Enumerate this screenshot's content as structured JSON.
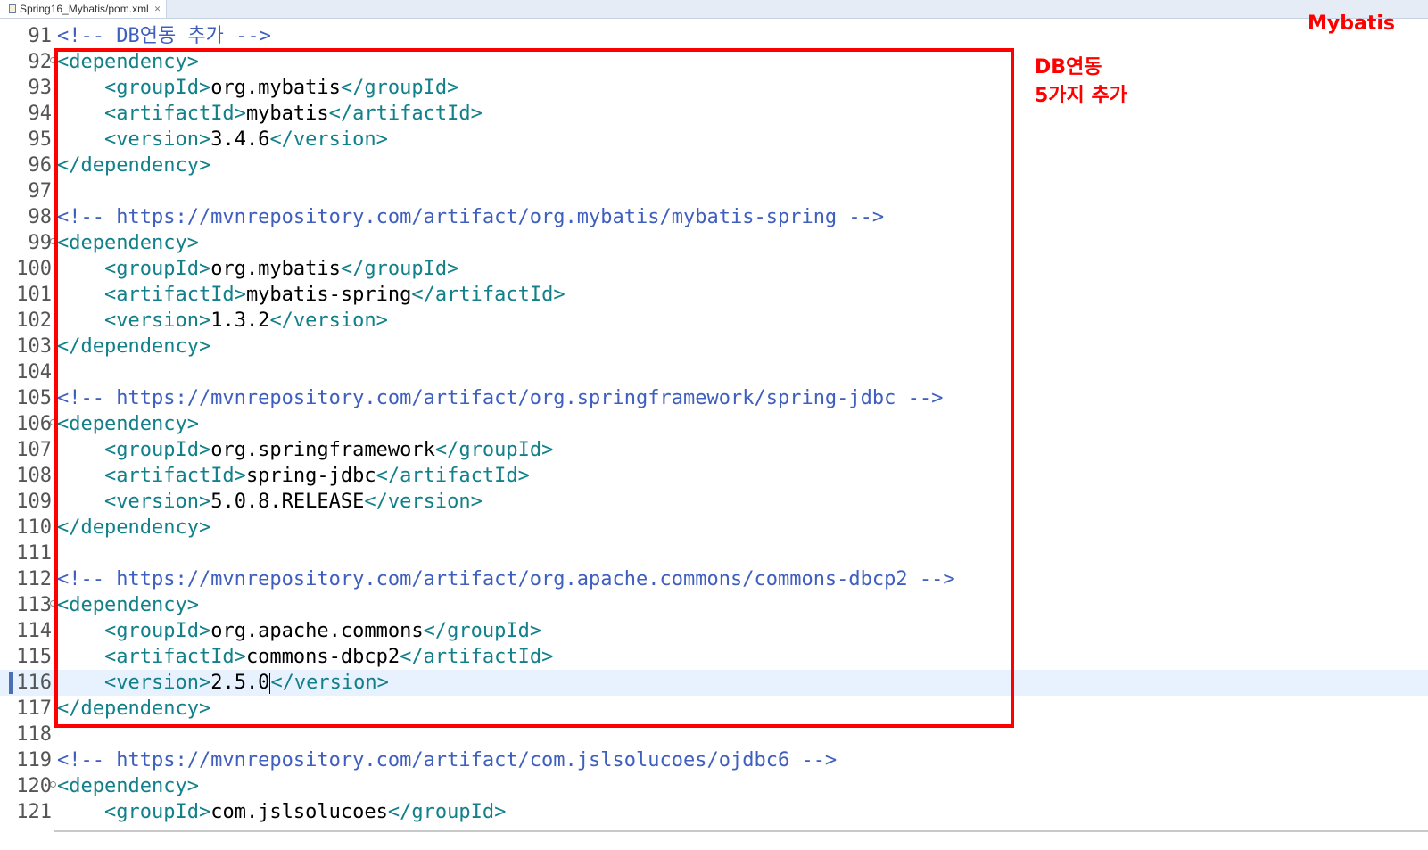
{
  "tab": {
    "title": "Spring16_Mybatis/pom.xml",
    "file_icon": "xml-file-icon",
    "close_glyph": "✕"
  },
  "annotations": {
    "corner": "Mybatis",
    "note_line1": "DB연동",
    "note_line2": "5가지 추가",
    "box_color": "#ff0000"
  },
  "editor": {
    "current_line": 116,
    "lines": [
      {
        "n": "91",
        "segs": [
          {
            "k": "cmt",
            "t": "<!-- DB연동 추가 -->"
          }
        ]
      },
      {
        "n": "92",
        "fold": true,
        "segs": [
          {
            "k": "tag",
            "t": "<dependency>"
          }
        ]
      },
      {
        "n": "93",
        "segs": [
          {
            "k": "txt",
            "t": "    "
          },
          {
            "k": "tag",
            "t": "<groupId>"
          },
          {
            "k": "txt",
            "t": "org.mybatis"
          },
          {
            "k": "tag",
            "t": "</groupId>"
          }
        ]
      },
      {
        "n": "94",
        "segs": [
          {
            "k": "txt",
            "t": "    "
          },
          {
            "k": "tag",
            "t": "<artifactId>"
          },
          {
            "k": "txt",
            "t": "mybatis"
          },
          {
            "k": "tag",
            "t": "</artifactId>"
          }
        ]
      },
      {
        "n": "95",
        "segs": [
          {
            "k": "txt",
            "t": "    "
          },
          {
            "k": "tag",
            "t": "<version>"
          },
          {
            "k": "txt",
            "t": "3.4.6"
          },
          {
            "k": "tag",
            "t": "</version>"
          }
        ]
      },
      {
        "n": "96",
        "segs": [
          {
            "k": "tag",
            "t": "</dependency>"
          }
        ]
      },
      {
        "n": "97",
        "segs": []
      },
      {
        "n": "98",
        "segs": [
          {
            "k": "cmt",
            "t": "<!-- https://mvnrepository.com/artifact/org.mybatis/mybatis-spring -->"
          }
        ]
      },
      {
        "n": "99",
        "fold": true,
        "segs": [
          {
            "k": "tag",
            "t": "<dependency>"
          }
        ]
      },
      {
        "n": "100",
        "segs": [
          {
            "k": "txt",
            "t": "    "
          },
          {
            "k": "tag",
            "t": "<groupId>"
          },
          {
            "k": "txt",
            "t": "org.mybatis"
          },
          {
            "k": "tag",
            "t": "</groupId>"
          }
        ]
      },
      {
        "n": "101",
        "segs": [
          {
            "k": "txt",
            "t": "    "
          },
          {
            "k": "tag",
            "t": "<artifactId>"
          },
          {
            "k": "txt",
            "t": "mybatis-spring"
          },
          {
            "k": "tag",
            "t": "</artifactId>"
          }
        ]
      },
      {
        "n": "102",
        "segs": [
          {
            "k": "txt",
            "t": "    "
          },
          {
            "k": "tag",
            "t": "<version>"
          },
          {
            "k": "txt",
            "t": "1.3.2"
          },
          {
            "k": "tag",
            "t": "</version>"
          }
        ]
      },
      {
        "n": "103",
        "segs": [
          {
            "k": "tag",
            "t": "</dependency>"
          }
        ]
      },
      {
        "n": "104",
        "segs": []
      },
      {
        "n": "105",
        "segs": [
          {
            "k": "cmt",
            "t": "<!-- https://mvnrepository.com/artifact/org.springframework/spring-jdbc -->"
          }
        ]
      },
      {
        "n": "106",
        "fold": true,
        "segs": [
          {
            "k": "tag",
            "t": "<dependency>"
          }
        ]
      },
      {
        "n": "107",
        "segs": [
          {
            "k": "txt",
            "t": "    "
          },
          {
            "k": "tag",
            "t": "<groupId>"
          },
          {
            "k": "txt",
            "t": "org.springframework"
          },
          {
            "k": "tag",
            "t": "</groupId>"
          }
        ]
      },
      {
        "n": "108",
        "segs": [
          {
            "k": "txt",
            "t": "    "
          },
          {
            "k": "tag",
            "t": "<artifactId>"
          },
          {
            "k": "txt",
            "t": "spring-jdbc"
          },
          {
            "k": "tag",
            "t": "</artifactId>"
          }
        ]
      },
      {
        "n": "109",
        "segs": [
          {
            "k": "txt",
            "t": "    "
          },
          {
            "k": "tag",
            "t": "<version>"
          },
          {
            "k": "txt",
            "t": "5.0.8.RELEASE"
          },
          {
            "k": "tag",
            "t": "</version>"
          }
        ]
      },
      {
        "n": "110",
        "segs": [
          {
            "k": "tag",
            "t": "</dependency>"
          }
        ]
      },
      {
        "n": "111",
        "segs": []
      },
      {
        "n": "112",
        "segs": [
          {
            "k": "cmt",
            "t": "<!-- https://mvnrepository.com/artifact/org.apache.commons/commons-dbcp2 -->"
          }
        ]
      },
      {
        "n": "113",
        "fold": true,
        "segs": [
          {
            "k": "tag",
            "t": "<dependency>"
          }
        ]
      },
      {
        "n": "114",
        "segs": [
          {
            "k": "txt",
            "t": "    "
          },
          {
            "k": "tag",
            "t": "<groupId>"
          },
          {
            "k": "txt",
            "t": "org.apache.commons"
          },
          {
            "k": "tag",
            "t": "</groupId>"
          }
        ]
      },
      {
        "n": "115",
        "segs": [
          {
            "k": "txt",
            "t": "    "
          },
          {
            "k": "tag",
            "t": "<artifactId>"
          },
          {
            "k": "txt",
            "t": "commons-dbcp2"
          },
          {
            "k": "tag",
            "t": "</artifactId>"
          }
        ]
      },
      {
        "n": "116",
        "current": true,
        "segs": [
          {
            "k": "txt",
            "t": "    "
          },
          {
            "k": "tag",
            "t": "<version>"
          },
          {
            "k": "txt",
            "t": "2.5.0"
          },
          {
            "k": "caret",
            "t": ""
          },
          {
            "k": "tag",
            "t": "</version>"
          }
        ]
      },
      {
        "n": "117",
        "segs": [
          {
            "k": "tag",
            "t": "</dependency>"
          }
        ]
      },
      {
        "n": "118",
        "segs": []
      },
      {
        "n": "119",
        "segs": [
          {
            "k": "cmt",
            "t": "<!-- https://mvnrepository.com/artifact/com.jslsolucoes/ojdbc6 -->"
          }
        ]
      },
      {
        "n": "120",
        "fold": true,
        "segs": [
          {
            "k": "tag",
            "t": "<dependency>"
          }
        ]
      },
      {
        "n": "121",
        "segs": [
          {
            "k": "txt",
            "t": "    "
          },
          {
            "k": "tag",
            "t": "<groupId>"
          },
          {
            "k": "txt",
            "t": "com.jslsolucoes"
          },
          {
            "k": "tag",
            "t": "</groupId>"
          }
        ]
      }
    ]
  }
}
